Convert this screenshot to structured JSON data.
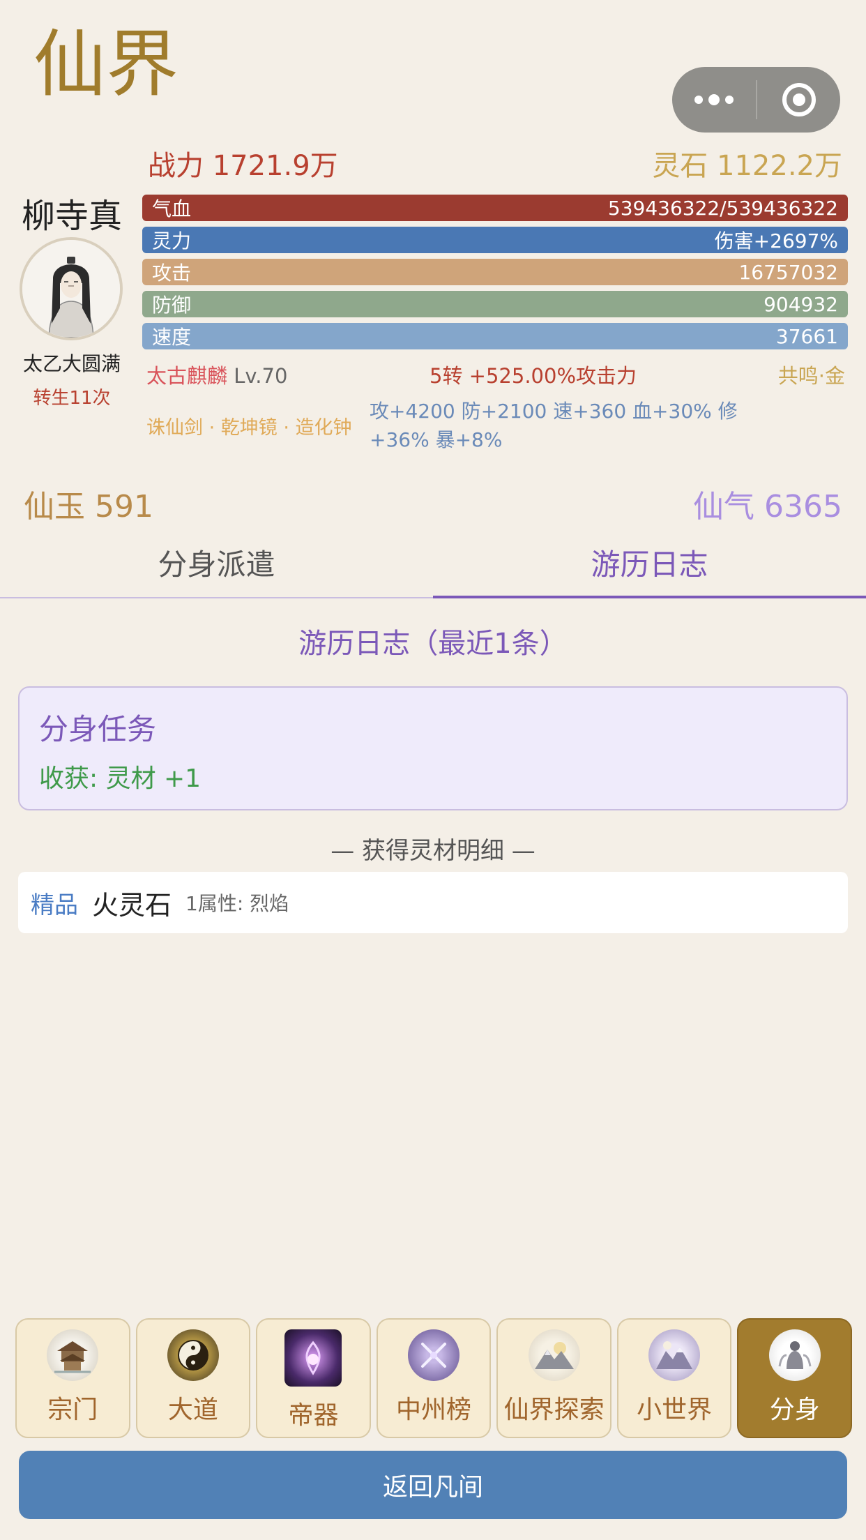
{
  "page": {
    "title": "仙界"
  },
  "header": {
    "power": "战力 1721.9万",
    "spirit_stone": "灵石 1122.2万"
  },
  "player": {
    "name": "柳寺真",
    "realm": "太乙大圆满",
    "rebirth": "转生11次"
  },
  "stats": {
    "hp": {
      "label": "气血",
      "value": "539436322/539436322"
    },
    "mp": {
      "label": "灵力",
      "value": "伤害+2697%"
    },
    "atk": {
      "label": "攻击",
      "value": "16757032"
    },
    "def": {
      "label": "防御",
      "value": "904932"
    },
    "spd": {
      "label": "速度",
      "value": "37661"
    }
  },
  "beast": {
    "name": "太古麒麟",
    "level": "Lv.70",
    "bonus": "5转 +525.00%攻击力",
    "resonance": "共鸣·金"
  },
  "artifacts": {
    "names": "诛仙剑 · 乾坤镜 · 造化钟",
    "bonus": "攻+4200 防+2100 速+360 血+30% 修+36% 暴+8%"
  },
  "currency": {
    "jade": "仙玉 591",
    "qi": "仙气 6365"
  },
  "tabs": {
    "dispatch": "分身派遣",
    "log": "游历日志"
  },
  "log": {
    "title": "游历日志（最近1条）",
    "entry_title": "分身任务",
    "entry_gain": "收获: 灵材 +1"
  },
  "details": {
    "title": "— 获得灵材明细 —",
    "item": {
      "quality": "精品",
      "name": "火灵石",
      "attr": "1属性: 烈焰"
    }
  },
  "nav": {
    "sect": "宗门",
    "dao": "大道",
    "emperor_artifact": "帝器",
    "zhongzhou_rank": "中州榜",
    "explore": "仙界探索",
    "small_world": "小世界",
    "clone": "分身"
  },
  "back_button": "返回凡间",
  "colors": {
    "gold": "#a07c2c",
    "purple": "#7b58b8",
    "blue_button": "#5181b6",
    "hp_bar": "#9b3b30",
    "mp_bar": "#4a78b4",
    "atk_bar": "#cfa47a",
    "def_bar": "#8fa88c",
    "spd_bar": "#84a6cb"
  },
  "icons": {
    "sect": "temple-icon",
    "dao": "taiji-icon",
    "emperor_artifact": "artifact-icon",
    "zhongzhou_rank": "crossed-swords-icon",
    "explore": "mountain-icon",
    "small_world": "world-icon",
    "clone": "clone-icon"
  }
}
